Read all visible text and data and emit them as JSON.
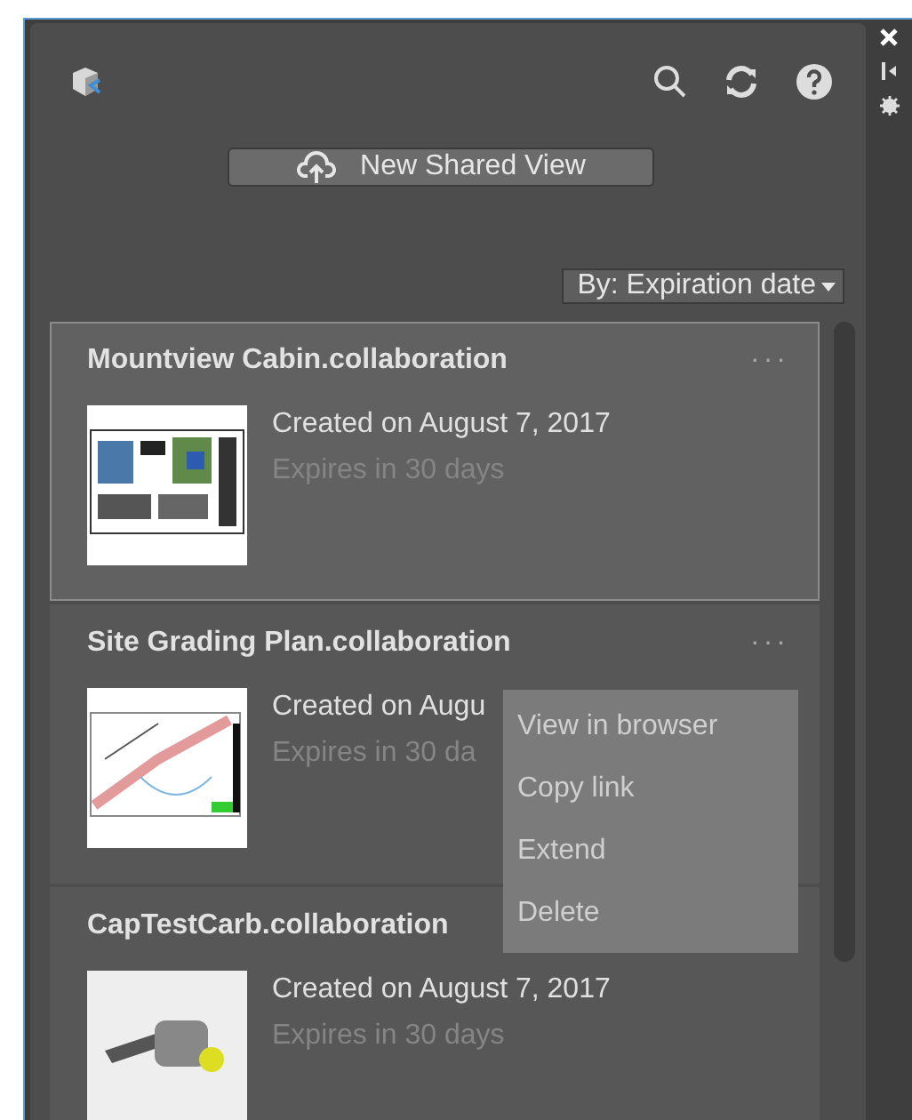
{
  "toolbar": {
    "new_button": "New Shared View",
    "sort": {
      "label": "By: Expiration date"
    }
  },
  "views": [
    {
      "title": "Mountview Cabin.collaboration",
      "more": "···",
      "created": "Created on August 7, 2017",
      "expires": "Expires in 30 days",
      "selected": true,
      "kind": "sheet"
    },
    {
      "title": "Site Grading Plan.collaboration",
      "more": "···",
      "created": "Created on Augu",
      "expires": "Expires in 30 da",
      "selected": false,
      "kind": "map"
    },
    {
      "title": "CapTestCarb.collaboration",
      "created": "Created on August 7, 2017",
      "expires": "Expires in 30 days",
      "selected": false,
      "kind": "part"
    }
  ],
  "context_menu": {
    "items": [
      "View in browser",
      "Copy link",
      "Extend",
      "Delete"
    ]
  }
}
